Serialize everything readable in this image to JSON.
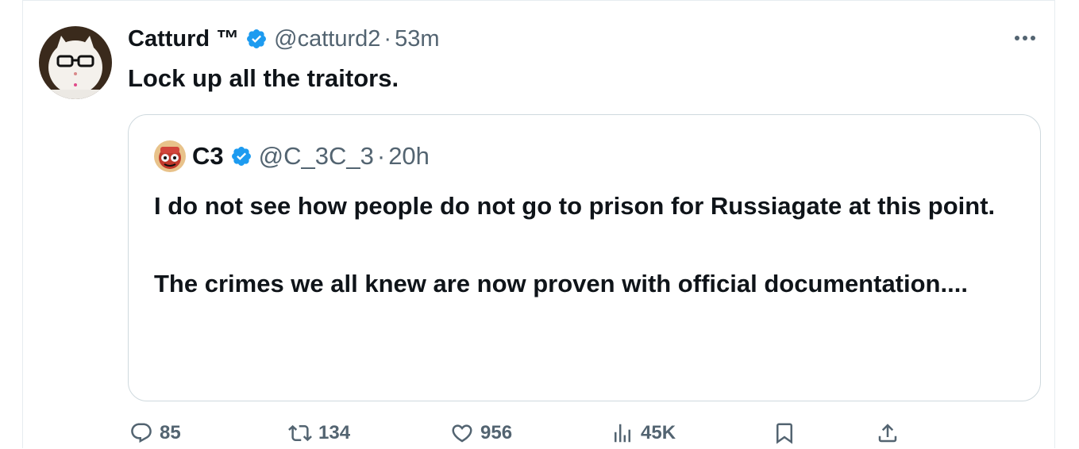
{
  "tweet": {
    "author_name": "Catturd ™",
    "author_handle": "@catturd2",
    "separator": "·",
    "time": "53m",
    "text": "Lock up all the traitors."
  },
  "quoted": {
    "author_name": "C3",
    "author_handle": "@C_3C_3",
    "separator": "·",
    "time": "20h",
    "paragraph_1": "I do not see how people do not go to prison for Russiagate at this point.",
    "paragraph_2": "The crimes we all knew are now proven with official documentation...."
  },
  "actions": {
    "replies": "85",
    "reposts": "134",
    "likes": "956",
    "views": "45K"
  },
  "icons": {
    "verified": "verified-badge-icon",
    "more": "more-dots-icon",
    "reply": "reply-bubble-icon",
    "repost": "repost-arrows-icon",
    "like": "heart-icon",
    "views": "views-chart-icon",
    "bookmark": "bookmark-icon",
    "share": "share-upload-icon"
  },
  "colors": {
    "verified": "#1d9bf0",
    "text": "#0f1419",
    "muted": "#536471",
    "border": "#cfd9de"
  }
}
